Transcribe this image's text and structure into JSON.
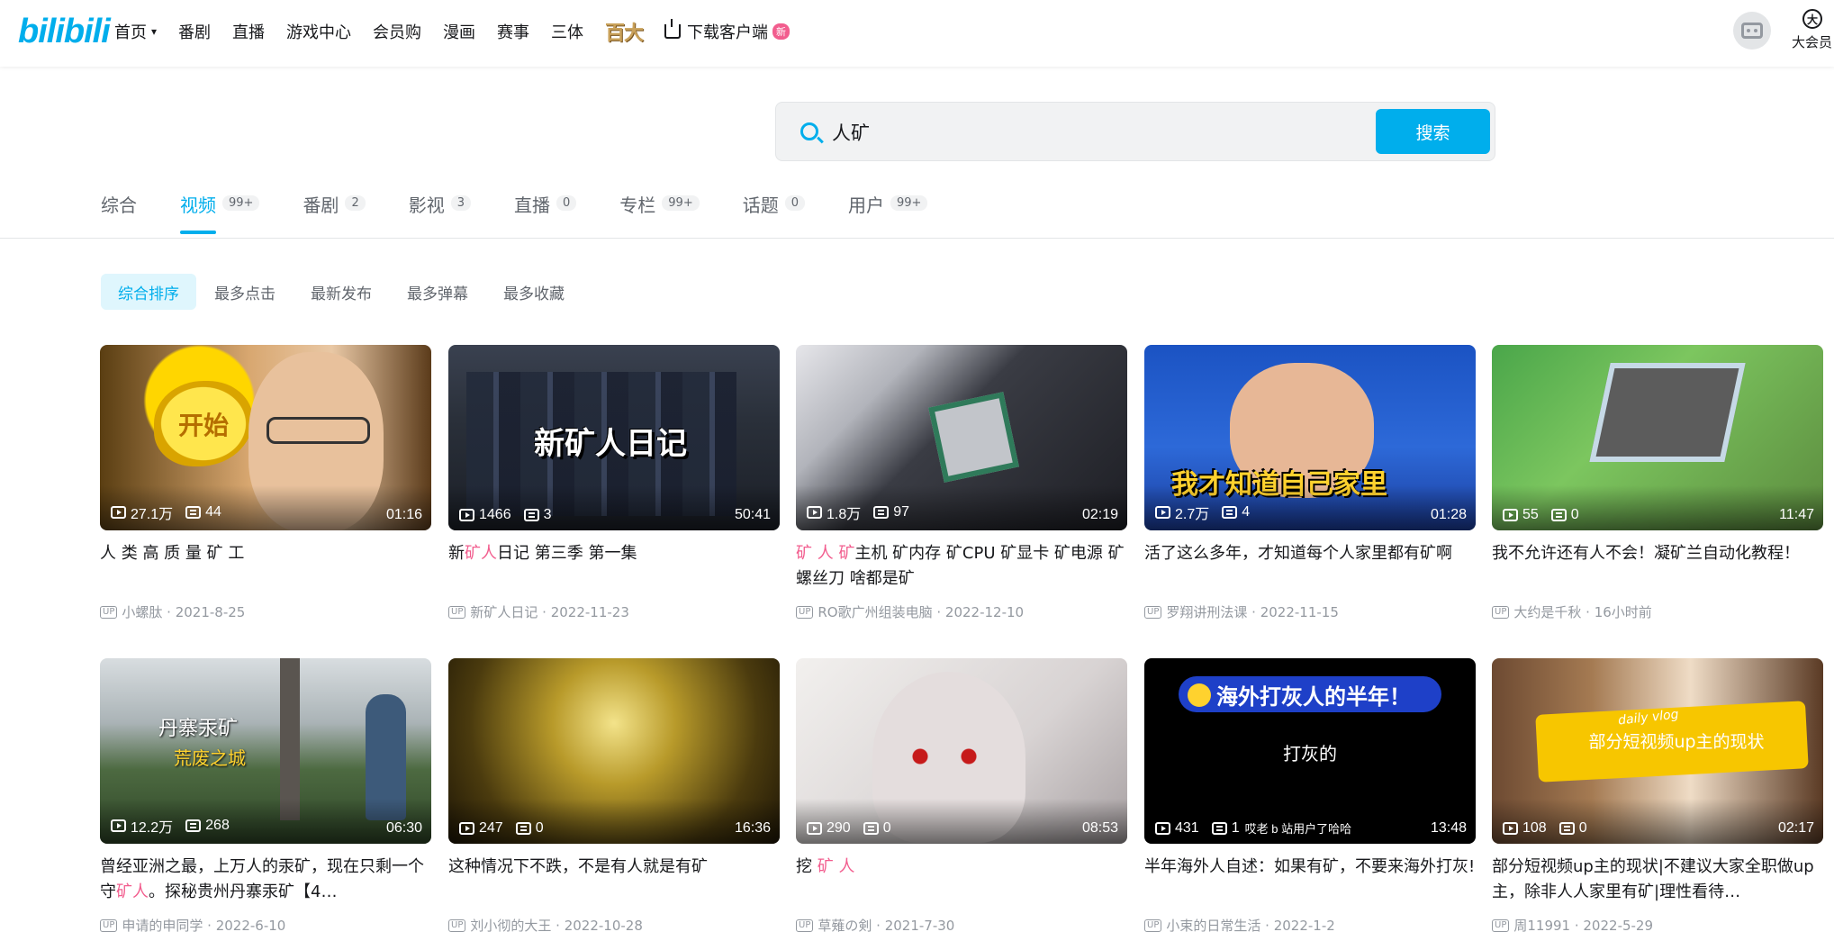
{
  "header": {
    "logo": "bilibili",
    "nav": [
      "首页",
      "番剧",
      "直播",
      "游戏中心",
      "会员购",
      "漫画",
      "赛事",
      "三体"
    ],
    "nav_special": "百大",
    "download_label": "下载客户端",
    "new_badge": "新",
    "vip_label": "大会员",
    "vip_icon_char": "大"
  },
  "search": {
    "query": "人矿",
    "button_label": "搜索"
  },
  "tabs": [
    {
      "label": "综合",
      "count": ""
    },
    {
      "label": "视频",
      "count": "99+"
    },
    {
      "label": "番剧",
      "count": "2"
    },
    {
      "label": "影视",
      "count": "3"
    },
    {
      "label": "直播",
      "count": "0"
    },
    {
      "label": "专栏",
      "count": "99+"
    },
    {
      "label": "话题",
      "count": "0"
    },
    {
      "label": "用户",
      "count": "99+"
    }
  ],
  "active_tab": "视频",
  "sorts": [
    "综合排序",
    "最多点击",
    "最新发布",
    "最多弹幕",
    "最多收藏"
  ],
  "active_sort": "综合排序",
  "colors": {
    "accent": "#00aeec",
    "highlight": "#f25d8e"
  },
  "videos": [
    {
      "title_parts": [
        {
          "t": "人 类 高 质 量 矿 工",
          "h": false
        }
      ],
      "plays": "27.1万",
      "danmaku": "44",
      "duration": "01:16",
      "up": "小螺肽",
      "date": "2021-8-25",
      "thumb_text": "开始"
    },
    {
      "title_parts": [
        {
          "t": "新",
          "h": false
        },
        {
          "t": "矿人",
          "h": true
        },
        {
          "t": "日记 第三季 第一集",
          "h": false
        }
      ],
      "plays": "1466",
      "danmaku": "3",
      "duration": "50:41",
      "up": "新矿人日记",
      "date": "2022-11-23",
      "thumb_text": "新矿人日记"
    },
    {
      "title_parts": [
        {
          "t": "矿 人 矿",
          "h": true
        },
        {
          "t": "主机 矿内存 矿CPU 矿显卡 矿电源 矿螺丝刀 啥都是矿",
          "h": false
        }
      ],
      "plays": "1.8万",
      "danmaku": "97",
      "duration": "02:19",
      "up": "RO歌广州组装电脑",
      "date": "2022-12-10",
      "thumb_text": ""
    },
    {
      "title_parts": [
        {
          "t": "活了这么多年，才知道每个人家里都有矿啊",
          "h": false
        }
      ],
      "plays": "2.7万",
      "danmaku": "4",
      "duration": "01:28",
      "up": "罗翔讲刑法课",
      "date": "2022-11-15",
      "thumb_text": "我才知道自己家里"
    },
    {
      "title_parts": [
        {
          "t": "我不允许还有人不会！凝矿兰自动化教程！",
          "h": false
        }
      ],
      "plays": "55",
      "danmaku": "0",
      "duration": "11:47",
      "up": "大约是千秋",
      "date": "16小时前",
      "thumb_text": ""
    },
    {
      "title_parts": [
        {
          "t": "曾经亚洲之最，上万人的汞矿，现在只剩一个守",
          "h": false
        },
        {
          "t": "矿人",
          "h": true
        },
        {
          "t": "。探秘贵州丹寨汞矿【4…",
          "h": false
        }
      ],
      "plays": "12.2万",
      "danmaku": "268",
      "duration": "06:30",
      "up": "申请的申同学",
      "date": "2022-6-10",
      "thumb_text": "丹寨汞矿",
      "thumb_text2": "荒废之城"
    },
    {
      "title_parts": [
        {
          "t": "这种情况下不跌，不是有人就是有矿",
          "h": false
        }
      ],
      "plays": "247",
      "danmaku": "0",
      "duration": "16:36",
      "up": "刘小彻的大王",
      "date": "2022-10-28",
      "thumb_text": ""
    },
    {
      "title_parts": [
        {
          "t": "挖 ",
          "h": false
        },
        {
          "t": "矿 人",
          "h": true
        }
      ],
      "plays": "290",
      "danmaku": "0",
      "duration": "08:53",
      "up": "草薙の剣",
      "date": "2021-7-30",
      "thumb_text": ""
    },
    {
      "title_parts": [
        {
          "t": "半年海外人自述：如果有矿，不要来海外打灰!",
          "h": false
        }
      ],
      "plays": "431",
      "danmaku": "1",
      "duration": "13:48",
      "up": "小束的日常生活",
      "date": "2022-1-2",
      "thumb_text": "海外打灰人的半年！",
      "thumb_text2": "打灰的",
      "extra_note": "哎老 b 站用户了哈哈"
    },
    {
      "title_parts": [
        {
          "t": "部分短视频up主的现状|不建议大家全职做up主，除非人人家里有矿|理性看待…",
          "h": false
        }
      ],
      "plays": "108",
      "danmaku": "0",
      "duration": "02:17",
      "up": "周11991",
      "date": "2022-5-29",
      "thumb_text": "daily vlog",
      "thumb_text2": "部分短视频up主的现状"
    }
  ],
  "up_tag": "UP"
}
